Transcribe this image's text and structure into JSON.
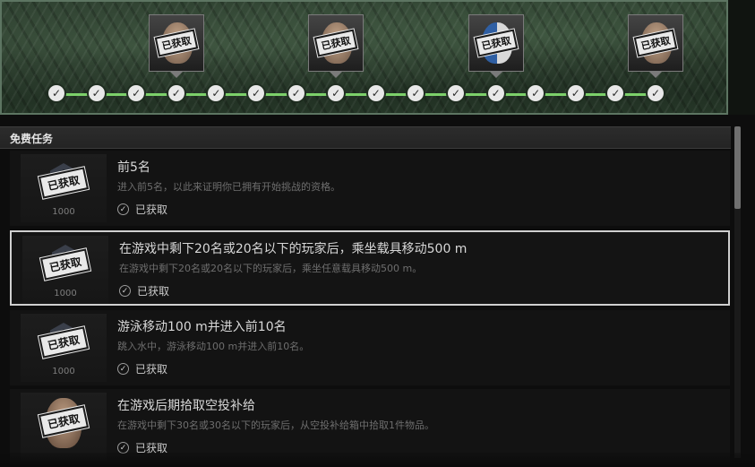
{
  "progress": {
    "stamp_text": "已获取",
    "node_count": 16,
    "node_check": "✓",
    "rewards": [
      {
        "node_index": 3,
        "icon": "character-face-icon",
        "variant": "plain"
      },
      {
        "node_index": 7,
        "icon": "character-face-icon",
        "variant": "plain"
      },
      {
        "node_index": 11,
        "icon": "character-face-icon",
        "variant": "painted"
      },
      {
        "node_index": 15,
        "icon": "character-face-icon",
        "variant": "plain"
      }
    ],
    "colors": {
      "track": "#7cd06a",
      "node": "#e8e8e8"
    }
  },
  "section": {
    "title": "免费任务"
  },
  "missions": [
    {
      "title": "前5名",
      "description": "进入前5名，以此来证明你已拥有开始挑战的资格。",
      "status": "已获取",
      "reward_points": "1000",
      "reward_type": "points",
      "stamp": "已获取",
      "selected": false
    },
    {
      "title": "在游戏中剩下20名或20名以下的玩家后，乘坐载具移动500 m",
      "description": "在游戏中剩下20名或20名以下的玩家后，乘坐任意载具移动500 m。",
      "status": "已获取",
      "reward_points": "1000",
      "reward_type": "points",
      "stamp": "已获取",
      "selected": true
    },
    {
      "title": "游泳移动100 m并进入前10名",
      "description": "跳入水中，游泳移动100 m并进入前10名。",
      "status": "已获取",
      "reward_points": "1000",
      "reward_type": "points",
      "stamp": "已获取",
      "selected": false
    },
    {
      "title": "在游戏后期拾取空投补给",
      "description": "在游戏中剩下30名或30名以下的玩家后，从空投补给箱中拾取1件物品。",
      "status": "已获取",
      "reward_points": "",
      "reward_type": "character",
      "stamp": "已获取",
      "selected": false
    }
  ]
}
